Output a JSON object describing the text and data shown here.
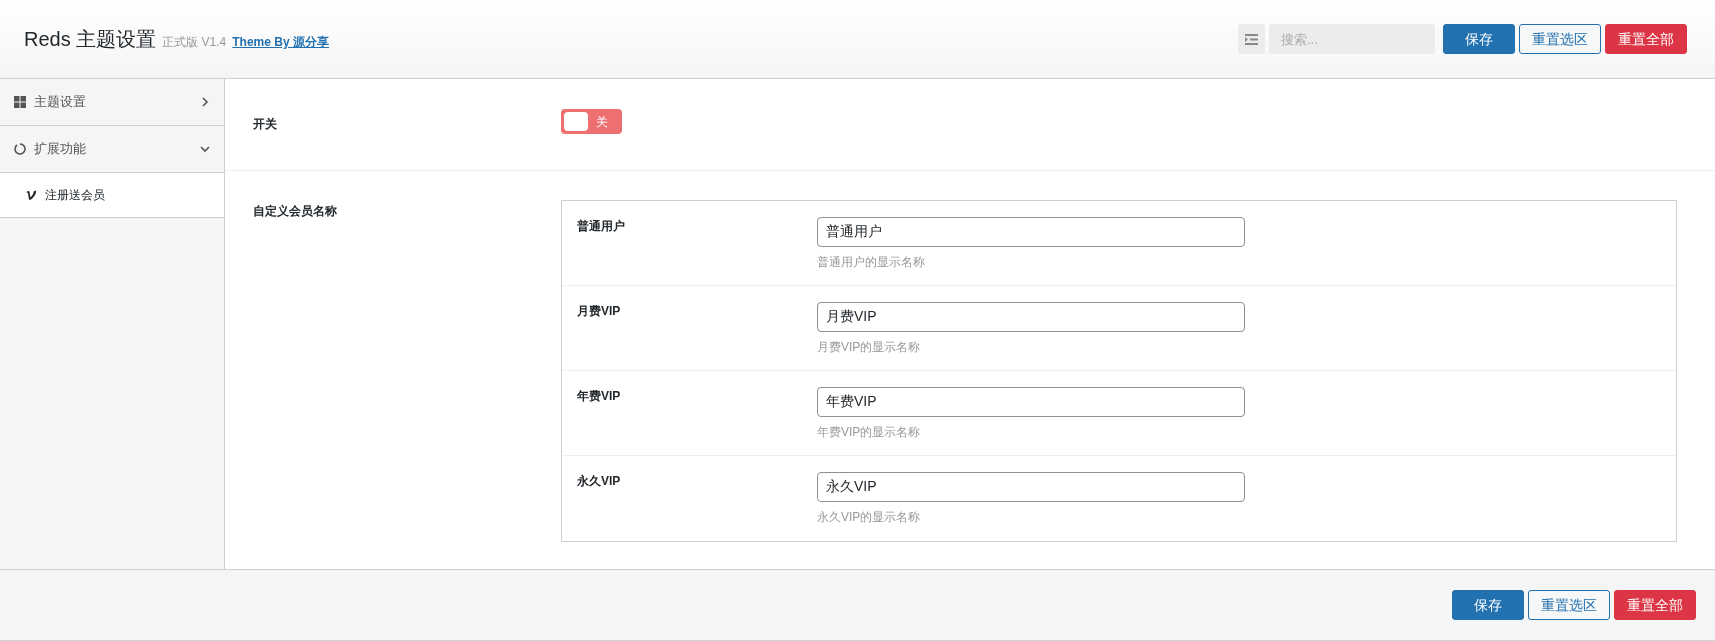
{
  "header": {
    "title": "Reds 主题设置",
    "edition": "正式版 V1.4",
    "credit_link": "Theme By 源分享",
    "search": {
      "placeholder": "搜索..."
    },
    "buttons": [
      {
        "label": "保存",
        "kind": "primary"
      },
      {
        "label": "重置选区",
        "kind": "outline"
      },
      {
        "label": "重置全部",
        "kind": "danger"
      }
    ]
  },
  "sidebar": {
    "items": [
      {
        "label": "主题设置",
        "kind": "grid",
        "expanded": false
      },
      {
        "label": "扩展功能",
        "kind": "circle",
        "expanded": true,
        "children": [
          {
            "label": "注册送会员",
            "selected": true
          }
        ]
      }
    ]
  },
  "fields": [
    {
      "label": "开关",
      "kind": "switch",
      "on": false,
      "switch_label": "关"
    },
    {
      "label": "自定义会员名称",
      "kind": "group",
      "rows": [
        {
          "label": "普通用户",
          "value": "普通用户",
          "hint": "普通用户的显示名称"
        },
        {
          "label": "月费VIP",
          "value": "月费VIP",
          "hint": "月费VIP的显示名称"
        },
        {
          "label": "年费VIP",
          "value": "年费VIP",
          "hint": "年费VIP的显示名称"
        },
        {
          "label": "永久VIP",
          "value": "永久VIP",
          "hint": "永久VIP的显示名称"
        }
      ]
    }
  ],
  "footer": {
    "buttons": [
      {
        "label": "保存",
        "kind": "primary"
      },
      {
        "label": "重置选区",
        "kind": "outline"
      },
      {
        "label": "重置全部",
        "kind": "danger"
      }
    ]
  }
}
